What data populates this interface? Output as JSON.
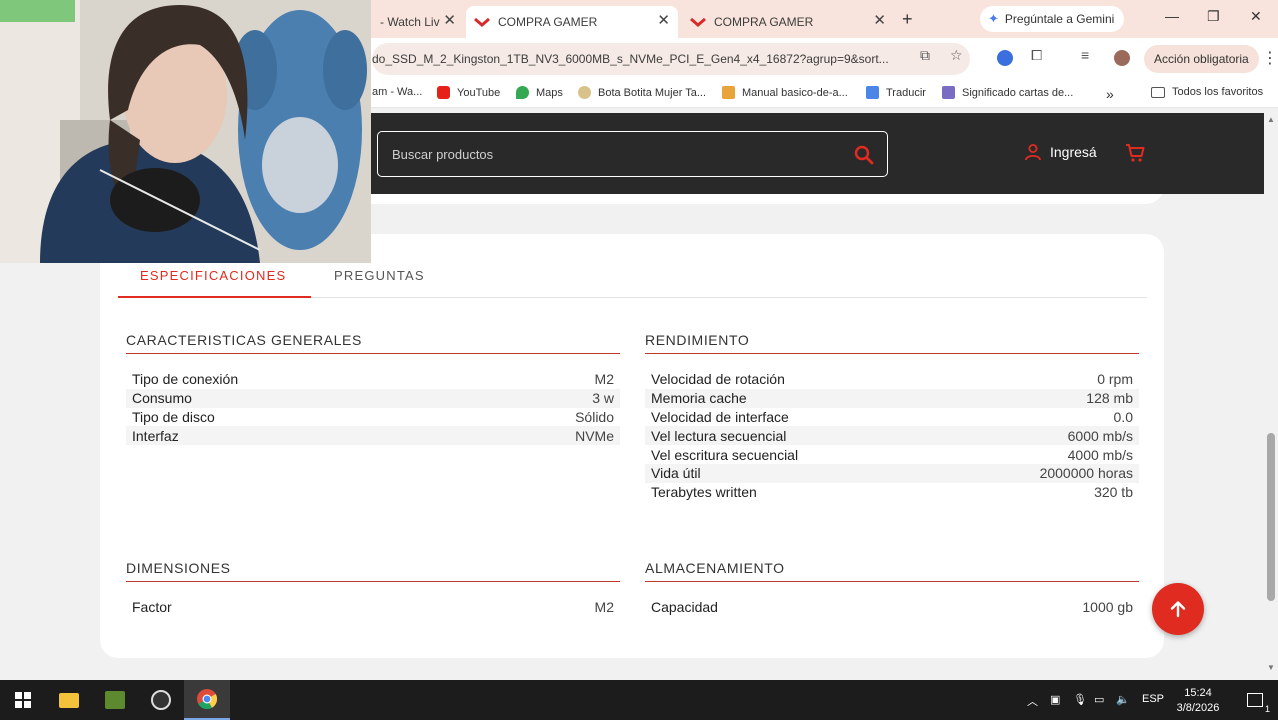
{
  "browser": {
    "tabs": [
      {
        "label": "- Watch Liv"
      },
      {
        "label": "COMPRA GAMER"
      },
      {
        "label": "COMPRA GAMER"
      }
    ],
    "new_tab": "+",
    "gemini_label": "Pregúntale a Gemini",
    "url": "do_SSD_M_2_Kingston_1TB_NV3_6000MB_s_NVMe_PCI_E_Gen4_x4_16872?agrup=9&sort...",
    "accion_label": "Acción obligatoria",
    "bookmarks": [
      {
        "label": "am - Wa..."
      },
      {
        "label": "YouTube"
      },
      {
        "label": "Maps"
      },
      {
        "label": "Bota Botita Mujer Ta..."
      },
      {
        "label": "Manual basico-de-a..."
      },
      {
        "label": "Traducir"
      },
      {
        "label": "Significado cartas de..."
      }
    ],
    "bookmarks_more": "»",
    "all_favorites": "Todos los favoritos"
  },
  "site": {
    "search_placeholder": "Buscar productos",
    "login_label": "Ingresá"
  },
  "product": {
    "tabs": [
      "ESPECIFICACIONES",
      "PREGUNTAS"
    ],
    "active_tab": "ESPECIFICACIONES",
    "sections": {
      "generales": {
        "title": "CARACTERISTICAS GENERALES",
        "rows": [
          {
            "k": "Tipo de conexión",
            "v": "M2"
          },
          {
            "k": "Consumo",
            "v": "3 w"
          },
          {
            "k": "Tipo de disco",
            "v": "Sólido"
          },
          {
            "k": "Interfaz",
            "v": "NVMe"
          }
        ]
      },
      "rendimiento": {
        "title": "RENDIMIENTO",
        "rows": [
          {
            "k": "Velocidad de rotación",
            "v": "0 rpm"
          },
          {
            "k": "Memoria cache",
            "v": "128 mb"
          },
          {
            "k": "Velocidad de interface",
            "v": "0.0"
          },
          {
            "k": "Vel lectura secuencial",
            "v": "6000 mb/s"
          },
          {
            "k": "Vel escritura secuencial",
            "v": "4000 mb/s"
          },
          {
            "k": "Vida útil",
            "v": "2000000 horas"
          },
          {
            "k": "Terabytes written",
            "v": "320 tb"
          }
        ]
      },
      "dimensiones": {
        "title": "DIMENSIONES",
        "rows": [
          {
            "k": "Factor",
            "v": "M2"
          }
        ]
      },
      "almacenamiento": {
        "title": "ALMACENAMIENTO",
        "rows": [
          {
            "k": "Capacidad",
            "v": "1000 gb"
          }
        ]
      }
    }
  },
  "taskbar": {
    "language": "ESP",
    "time": "15:24",
    "date": "3/8/2026",
    "notifications": "1"
  },
  "colors": {
    "accent": "#e02b20",
    "header_bg": "#292929",
    "tabbar_bg": "#f8e4dc"
  }
}
